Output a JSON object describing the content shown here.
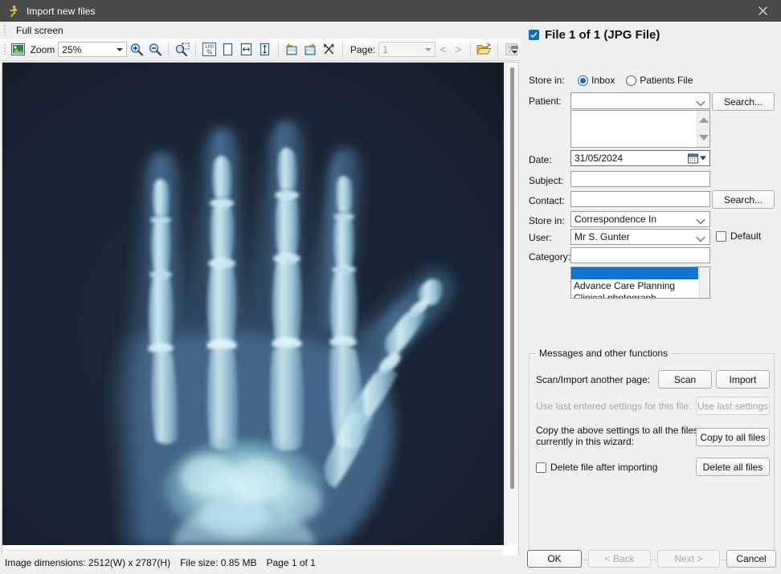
{
  "window": {
    "title": "Import new files",
    "app_icon": "runner-icon",
    "close_label": "✕"
  },
  "viewer": {
    "menu": {
      "full_screen": "Full screen"
    },
    "toolbar": {
      "image_icon": "image-icon",
      "zoom_label": "Zoom",
      "zoom_value": "25%",
      "zoom_in_icon": "zoom-in-icon",
      "zoom_out_icon": "zoom-out-icon",
      "zoom_area_icon": "zoom-select-area-icon",
      "zoom_100_icon": "zoom-100-percent-icon",
      "fit_page_icon": "fit-page-icon",
      "fit_width_icon": "fit-width-icon",
      "fit_height_icon": "fit-height-icon",
      "rotate_left_icon": "rotate-left-icon",
      "rotate_right_icon": "rotate-right-icon",
      "crop_icon": "crop-icon",
      "page_label": "Page:",
      "page_value": "1",
      "prev_page_icon": "prev-page-icon",
      "prev_page_glyph": "<",
      "next_page_icon": "next-page-icon",
      "next_page_glyph": ">",
      "open_folder_icon": "open-folder-icon",
      "delete_image_icon": "delete-image-icon",
      "overflow_icon": "toolbar-overflow-icon"
    },
    "image": {
      "alt": "hand-xray-image",
      "background": "#0b1724"
    },
    "status": {
      "dimensions": "Image dimensions: 2512(W) x 2787(H)",
      "file_size": "File size: 0.85 MB",
      "page": "Page 1 of 1"
    }
  },
  "panel": {
    "heading": "File 1 of 1 (JPG File)",
    "heading_checked": true,
    "store_in_label": "Store in:",
    "store_in_options": [
      "Inbox",
      "Patients File"
    ],
    "store_in_selected": "Inbox",
    "patient_label": "Patient:",
    "patient_value": "",
    "patient_search_button": "Search...",
    "date_label": "Date:",
    "date_value": "31/05/2024",
    "date_picker_icon": "calendar-icon",
    "subject_label": "Subject:",
    "subject_value": "",
    "contact_label": "Contact:",
    "contact_value": "",
    "contact_search_button": "Search...",
    "store_in2_label": "Store in:",
    "store_in2_value": "Correspondence In",
    "user_label": "User:",
    "user_value": "Mr S. Gunter",
    "default_checkbox_label": "Default",
    "default_checked": false,
    "category_label": "Category:",
    "category_value": "",
    "category_options": [
      "",
      "Advance Care Planning",
      "Clinical photograph"
    ],
    "category_selected_index": 0
  },
  "messages_group": {
    "title": "Messages and other functions",
    "scan_import_label": "Scan/Import another page:",
    "scan_button": "Scan",
    "import_button": "Import",
    "use_last_label": "Use last entered settings for this file:",
    "use_last_button": "Use last settings",
    "use_last_enabled": false,
    "copy_label_line1": "Copy the above settings to all the files",
    "copy_label_line2": "currently in this wizard:",
    "copy_button": "Copy to all files",
    "delete_checkbox_label": "Delete file after importing",
    "delete_checked": false,
    "delete_all_button": "Delete all files"
  },
  "footer": {
    "ok_button": "OK",
    "back_button": "< Back",
    "back_enabled": false,
    "next_button": "Next >",
    "next_enabled": false,
    "cancel_button": "Cancel"
  },
  "colors": {
    "titlebar": "#4a4a4a",
    "accent": "#0d6ec1",
    "selection": "#0c77d1",
    "panel_bg": "#f0f0f0"
  }
}
